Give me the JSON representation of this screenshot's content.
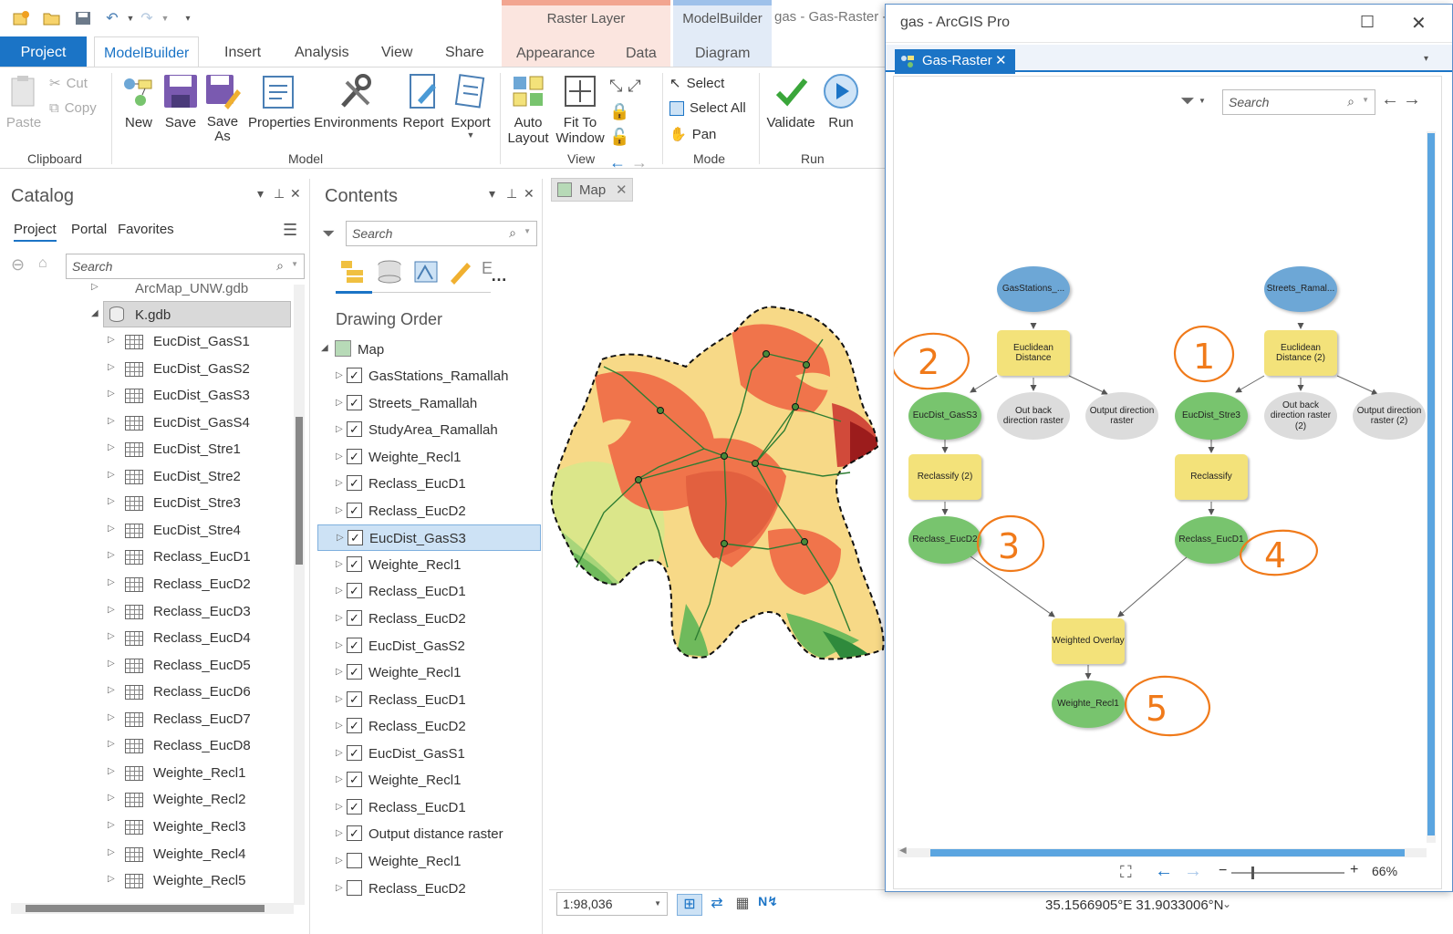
{
  "qat": {
    "undo": "↶",
    "redo": "↷"
  },
  "ribbon_tabs": {
    "project": "Project",
    "modelbuilder": "ModelBuilder",
    "insert": "Insert",
    "analysis": "Analysis",
    "view": "View",
    "share": "Share",
    "raster_layer_title": "Raster Layer",
    "appearance": "Appearance",
    "data": "Data",
    "modelbuilder_title": "ModelBuilder",
    "diagram": "Diagram",
    "doc_title": "gas - Gas-Raster -"
  },
  "ribbon": {
    "paste": "Paste",
    "cut": "Cut",
    "copy": "Copy",
    "clipboard_group": "Clipboard",
    "new": "New",
    "save": "Save",
    "save_as_1": "Save",
    "save_as_2": "As",
    "properties": "Properties",
    "environments": "Environments",
    "report": "Report",
    "export": "Export",
    "model_group": "Model",
    "auto_layout_1": "Auto",
    "auto_layout_2": "Layout",
    "fit_window_1": "Fit To",
    "fit_window_2": "Window",
    "view_group": "View",
    "select": "Select",
    "select_all": "Select All",
    "pan": "Pan",
    "mode_group": "Mode",
    "validate": "Validate",
    "run": "Run",
    "run_group": "Run"
  },
  "catalog": {
    "title": "Catalog",
    "tabs": [
      "Project",
      "Portal",
      "Favorites"
    ],
    "search_placeholder": "Search",
    "partial_item": "ArcMap_UNW.gdb",
    "gdb": "K.gdb",
    "items": [
      "EucDist_GasS1",
      "EucDist_GasS2",
      "EucDist_GasS3",
      "EucDist_GasS4",
      "EucDist_Stre1",
      "EucDist_Stre2",
      "EucDist_Stre3",
      "EucDist_Stre4",
      "Reclass_EucD1",
      "Reclass_EucD2",
      "Reclass_EucD3",
      "Reclass_EucD4",
      "Reclass_EucD5",
      "Reclass_EucD6",
      "Reclass_EucD7",
      "Reclass_EucD8",
      "Weighte_Recl1",
      "Weighte_Recl2",
      "Weighte_Recl3",
      "Weighte_Recl4",
      "Weighte_Recl5"
    ]
  },
  "contents": {
    "title": "Contents",
    "search_placeholder": "Search",
    "drawing_order": "Drawing Order",
    "map": "Map",
    "layers": [
      {
        "name": "GasStations_Ramallah",
        "checked": true
      },
      {
        "name": "Streets_Ramallah",
        "checked": true
      },
      {
        "name": "StudyArea_Ramallah",
        "checked": true
      },
      {
        "name": "Weighte_Recl1",
        "checked": true
      },
      {
        "name": "Reclass_EucD1",
        "checked": true
      },
      {
        "name": "Reclass_EucD2",
        "checked": true
      },
      {
        "name": "EucDist_GasS3",
        "checked": true,
        "selected": true
      },
      {
        "name": "Weighte_Recl1",
        "checked": true
      },
      {
        "name": "Reclass_EucD1",
        "checked": true
      },
      {
        "name": "Reclass_EucD2",
        "checked": true
      },
      {
        "name": "EucDist_GasS2",
        "checked": true
      },
      {
        "name": "Weighte_Recl1",
        "checked": true
      },
      {
        "name": "Reclass_EucD1",
        "checked": true
      },
      {
        "name": "Reclass_EucD2",
        "checked": true
      },
      {
        "name": "EucDist_GasS1",
        "checked": true
      },
      {
        "name": "Weighte_Recl1",
        "checked": true
      },
      {
        "name": "Reclass_EucD1",
        "checked": true
      },
      {
        "name": "Output distance raster",
        "checked": true
      },
      {
        "name": "Weighte_Recl1",
        "checked": false
      },
      {
        "name": "Reclass_EucD2",
        "checked": false
      }
    ]
  },
  "map": {
    "tab": "Map",
    "scale": "1:98,036",
    "coords": "35.1566905°E 31.9033006°N"
  },
  "mbwindow": {
    "title": "gas - ArcGIS Pro",
    "tab": "Gas-Raster",
    "search_placeholder": "Search",
    "zoom": "66%"
  },
  "model": {
    "gasstations": "GasStations_...",
    "streets": "Streets_Ramal...",
    "euc1": "Euclidean Distance",
    "euc2": "Euclidean Distance (2)",
    "eucdist_gass3": "EucDist_GasS3",
    "outback1": "Out back direction raster",
    "outdir1": "Output direction raster",
    "eucdist_stre3": "EucDist_Stre3",
    "outback2": "Out back direction raster (2)",
    "outdir2": "Output direction raster (2)",
    "reclassify2": "Reclassify (2)",
    "reclassify": "Reclassify",
    "reclass_eucd2": "Reclass_EucD2",
    "reclass_eucd1": "Reclass_EucD1",
    "weighted_overlay": "Weighted Overlay",
    "weighte_recl1": "Weighte_Recl1",
    "annotations": [
      "2",
      "1",
      "3",
      "4",
      "5"
    ]
  },
  "colors": {
    "accent": "#1b74c6",
    "node_blue": "#6da7d6",
    "node_green": "#78c46e",
    "node_yellow": "#f3e27a",
    "node_grey": "#dcdcdc",
    "annotation": "#f07a1a"
  }
}
